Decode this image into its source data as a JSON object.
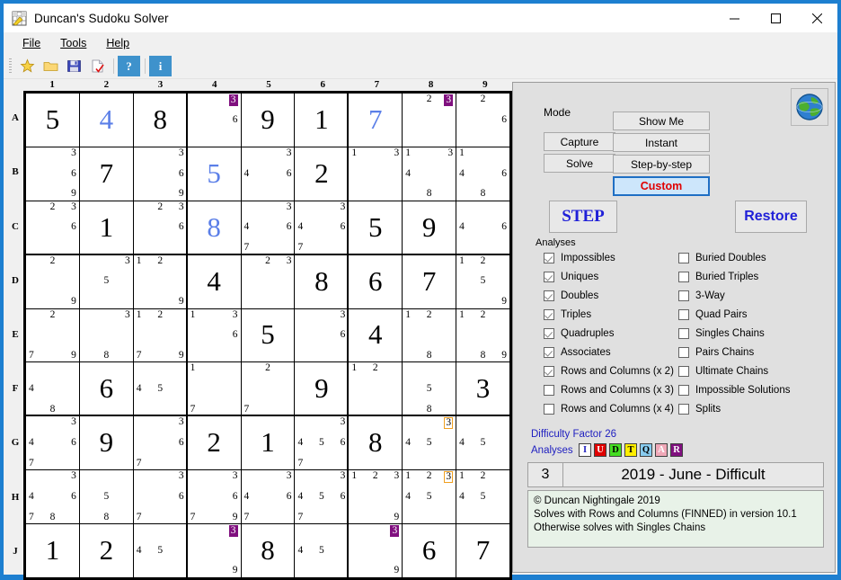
{
  "window": {
    "title": "Duncan's Sudoku Solver",
    "minimize": "minimize-button",
    "maximize": "maximize-button",
    "close": "close-button"
  },
  "menu": [
    "File",
    "Tools",
    "Help"
  ],
  "toolbar": {
    "items": [
      "star-icon",
      "open-folder-icon",
      "save-icon",
      "new-check-icon"
    ],
    "help_label": "?",
    "info_label": "i"
  },
  "grid": {
    "col_headers": [
      "1",
      "2",
      "3",
      "4",
      "5",
      "6",
      "7",
      "8",
      "9"
    ],
    "row_headers": [
      "A",
      "B",
      "C",
      "D",
      "E",
      "F",
      "G",
      "H",
      "J"
    ],
    "cells": [
      [
        {
          "v": "5"
        },
        {
          "v": "4",
          "solved": true
        },
        {
          "v": "8"
        },
        {
          "c": [
            3,
            6
          ],
          "marks": {
            "3": "fill"
          }
        },
        {
          "v": "9"
        },
        {
          "v": "1"
        },
        {
          "v": "7",
          "solved": true
        },
        {
          "c": [
            2,
            3
          ],
          "marks": {
            "3": "fill"
          }
        },
        {
          "c": [
            2,
            6
          ]
        }
      ],
      [
        {
          "c": [
            3,
            6,
            9
          ]
        },
        {
          "v": "7"
        },
        {
          "c": [
            3,
            6,
            9
          ]
        },
        {
          "v": "5",
          "solved": true
        },
        {
          "c": [
            4,
            3,
            6
          ]
        },
        {
          "v": "2"
        },
        {
          "c": [
            1,
            3
          ]
        },
        {
          "c": [
            1,
            3,
            4,
            8
          ]
        },
        {
          "c": [
            1,
            4,
            6,
            8
          ]
        }
      ],
      [
        {
          "c": [
            2,
            3,
            6
          ]
        },
        {
          "v": "1"
        },
        {
          "c": [
            2,
            3,
            6
          ]
        },
        {
          "v": "8",
          "solved": true
        },
        {
          "c": [
            4,
            7,
            3,
            6
          ]
        },
        {
          "c": [
            4,
            7,
            3,
            6
          ]
        },
        {
          "v": "5"
        },
        {
          "v": "9"
        },
        {
          "c": [
            4,
            6
          ]
        }
      ],
      [
        {
          "c": [
            2,
            9
          ]
        },
        {
          "c": [
            3,
            5
          ]
        },
        {
          "c": [
            1,
            2,
            9
          ]
        },
        {
          "v": "4"
        },
        {
          "c": [
            2,
            3
          ]
        },
        {
          "v": "8"
        },
        {
          "v": "6"
        },
        {
          "v": "7"
        },
        {
          "c": [
            1,
            2,
            5,
            9
          ]
        }
      ],
      [
        {
          "c": [
            2,
            7,
            9
          ]
        },
        {
          "c": [
            3,
            8
          ]
        },
        {
          "c": [
            1,
            2,
            7,
            9
          ]
        },
        {
          "c": [
            1,
            3,
            6
          ]
        },
        {
          "v": "5"
        },
        {
          "c": [
            3,
            6
          ]
        },
        {
          "v": "4"
        },
        {
          "c": [
            1,
            2,
            8
          ]
        },
        {
          "c": [
            1,
            2,
            8,
            9
          ]
        }
      ],
      [
        {
          "c": [
            4,
            8
          ]
        },
        {
          "v": "6"
        },
        {
          "c": [
            4,
            5
          ]
        },
        {
          "c": [
            1,
            7
          ]
        },
        {
          "c": [
            2,
            7
          ]
        },
        {
          "v": "9"
        },
        {
          "c": [
            1,
            2
          ]
        },
        {
          "c": [
            5,
            8
          ]
        },
        {
          "v": "3"
        }
      ],
      [
        {
          "c": [
            4,
            7,
            3,
            6
          ]
        },
        {
          "v": "9"
        },
        {
          "c": [
            7,
            3,
            6
          ]
        },
        {
          "v": "2"
        },
        {
          "v": "1"
        },
        {
          "c": [
            4,
            5,
            6,
            7,
            3
          ]
        },
        {
          "v": "8"
        },
        {
          "c": [
            4,
            5,
            3
          ],
          "marks": {
            "3": "outline"
          }
        },
        {
          "c": [
            4,
            5
          ]
        }
      ],
      [
        {
          "c": [
            4,
            7,
            8,
            3,
            6
          ]
        },
        {
          "c": [
            5,
            8
          ]
        },
        {
          "c": [
            7,
            3,
            6
          ]
        },
        {
          "c": [
            7,
            3,
            6,
            9
          ]
        },
        {
          "c": [
            4,
            7,
            3,
            6
          ]
        },
        {
          "c": [
            4,
            5,
            7,
            3,
            6
          ]
        },
        {
          "c": [
            1,
            2,
            3,
            9
          ]
        },
        {
          "c": [
            1,
            2,
            4,
            5,
            3
          ],
          "marks": {
            "3": "outline"
          }
        },
        {
          "c": [
            1,
            2,
            4,
            5
          ]
        }
      ],
      [
        {
          "v": "1"
        },
        {
          "v": "2"
        },
        {
          "c": [
            4,
            5
          ]
        },
        {
          "c": [
            3,
            9
          ],
          "marks": {
            "3": "fill"
          }
        },
        {
          "v": "8"
        },
        {
          "c": [
            4,
            5
          ]
        },
        {
          "c": [
            3,
            9
          ],
          "marks": {
            "3": "fill"
          }
        },
        {
          "v": "6"
        },
        {
          "v": "7"
        }
      ]
    ]
  },
  "panel": {
    "mode_label": "Mode",
    "globe_icon": "globe-icon",
    "buttons": {
      "capture": "Capture",
      "solve": "Solve",
      "show_me": "Show Me",
      "instant": "Instant",
      "step_by_step": "Step-by-step",
      "custom": "Custom",
      "step": "STEP",
      "restore": "Restore"
    },
    "analyses_label": "Analyses",
    "analyses_left": [
      {
        "label": "Impossibles",
        "checked": true
      },
      {
        "label": "Uniques",
        "checked": true
      },
      {
        "label": "Doubles",
        "checked": true
      },
      {
        "label": "Triples",
        "checked": true
      },
      {
        "label": "Quadruples",
        "checked": true
      },
      {
        "label": "Associates",
        "checked": true
      },
      {
        "label": "Rows and Columns (x 2)",
        "checked": true
      },
      {
        "label": "Rows and Columns (x 3)",
        "checked": false
      },
      {
        "label": "Rows and Columns (x 4)",
        "checked": false
      }
    ],
    "analyses_right": [
      {
        "label": "Buried Doubles",
        "checked": false
      },
      {
        "label": "Buried Triples",
        "checked": false
      },
      {
        "label": "3-Way",
        "checked": false
      },
      {
        "label": "Quad Pairs",
        "checked": false
      },
      {
        "label": "Singles Chains",
        "checked": false
      },
      {
        "label": "Pairs Chains",
        "checked": false
      },
      {
        "label": "Ultimate Chains",
        "checked": false
      },
      {
        "label": "Impossible Solutions",
        "checked": false
      },
      {
        "label": "Splits",
        "checked": false
      }
    ],
    "difficulty": "Difficulty Factor 26",
    "analyses_badges_label": "Analyses",
    "badges": [
      {
        "letter": "I",
        "bg": "#ffffff",
        "fg": "#2020c0"
      },
      {
        "letter": "U",
        "bg": "#e00000",
        "fg": "#ffffff"
      },
      {
        "letter": "D",
        "bg": "#44dd22",
        "fg": "#000000"
      },
      {
        "letter": "T",
        "bg": "#ffee00",
        "fg": "#000000"
      },
      {
        "letter": "Q",
        "bg": "#88ccf0",
        "fg": "#000000"
      },
      {
        "letter": "A",
        "bg": "#f0a8b8",
        "fg": "#ffffff"
      },
      {
        "letter": "R",
        "bg": "#80107f",
        "fg": "#ffffff"
      }
    ],
    "puzzle_number": "3",
    "puzzle_title": "2019 - June - Difficult",
    "notes": [
      "© Duncan Nightingale 2019",
      "Solves with Rows and Columns (FINNED) in version 10.1",
      "Otherwise solves with Singles Chains"
    ]
  }
}
